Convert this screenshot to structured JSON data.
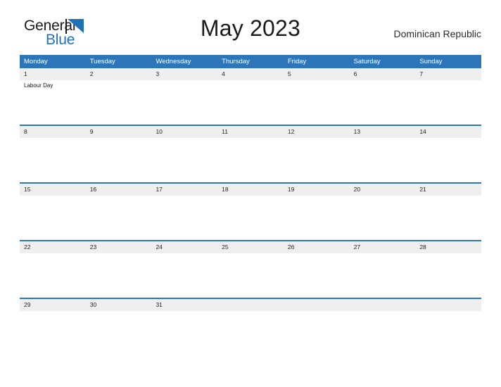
{
  "logo": {
    "word1": "General",
    "word2": "Blue",
    "triangle_color": "#1f72b8",
    "word2_color": "#1f72b8",
    "word1_color": "#1c1c1c"
  },
  "header": {
    "title": "May 2023",
    "country": "Dominican Republic"
  },
  "theme": {
    "header_blue": "#2b75b8",
    "band_gray": "#efefef",
    "cell_white": "#ffffff",
    "text_dark": "#1a1a1a"
  },
  "calendar": {
    "weekdays": [
      "Monday",
      "Tuesday",
      "Wednesday",
      "Thursday",
      "Friday",
      "Saturday",
      "Sunday"
    ],
    "weeks": [
      {
        "days": [
          {
            "date": "1",
            "event": "Labour Day"
          },
          {
            "date": "2",
            "event": ""
          },
          {
            "date": "3",
            "event": ""
          },
          {
            "date": "4",
            "event": ""
          },
          {
            "date": "5",
            "event": ""
          },
          {
            "date": "6",
            "event": ""
          },
          {
            "date": "7",
            "event": ""
          }
        ]
      },
      {
        "days": [
          {
            "date": "8",
            "event": ""
          },
          {
            "date": "9",
            "event": ""
          },
          {
            "date": "10",
            "event": ""
          },
          {
            "date": "11",
            "event": ""
          },
          {
            "date": "12",
            "event": ""
          },
          {
            "date": "13",
            "event": ""
          },
          {
            "date": "14",
            "event": ""
          }
        ]
      },
      {
        "days": [
          {
            "date": "15",
            "event": ""
          },
          {
            "date": "16",
            "event": ""
          },
          {
            "date": "17",
            "event": ""
          },
          {
            "date": "18",
            "event": ""
          },
          {
            "date": "19",
            "event": ""
          },
          {
            "date": "20",
            "event": ""
          },
          {
            "date": "21",
            "event": ""
          }
        ]
      },
      {
        "days": [
          {
            "date": "22",
            "event": ""
          },
          {
            "date": "23",
            "event": ""
          },
          {
            "date": "24",
            "event": ""
          },
          {
            "date": "25",
            "event": ""
          },
          {
            "date": "26",
            "event": ""
          },
          {
            "date": "27",
            "event": ""
          },
          {
            "date": "28",
            "event": ""
          }
        ]
      },
      {
        "days": [
          {
            "date": "29",
            "event": ""
          },
          {
            "date": "30",
            "event": ""
          },
          {
            "date": "31",
            "event": ""
          },
          {
            "date": "",
            "event": ""
          },
          {
            "date": "",
            "event": ""
          },
          {
            "date": "",
            "event": ""
          },
          {
            "date": "",
            "event": ""
          }
        ]
      }
    ]
  }
}
